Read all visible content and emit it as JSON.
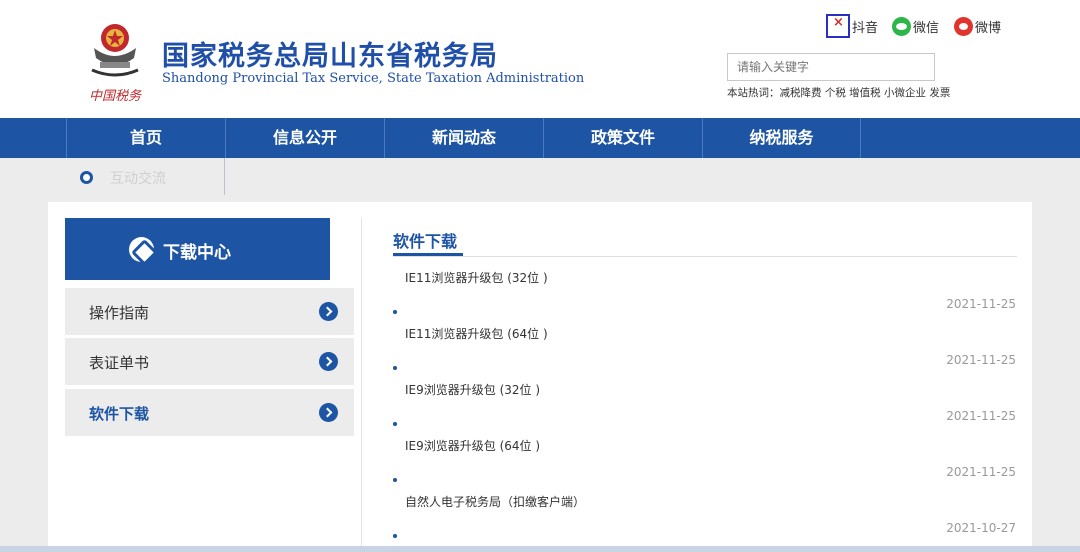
{
  "header": {
    "title_cn": "国家税务总局山东省税务局",
    "title_en": "Shandong Provincial Tax Service, State Taxation Administration",
    "social": {
      "douyin": "抖音",
      "wechat": "微信",
      "weibo": "微博"
    },
    "search": {
      "placeholder": "请输入关键字"
    },
    "hot_words": "本站热词：减税降费 个税 增值税 小微企业 发票"
  },
  "nav": {
    "items": [
      "首页",
      "信息公开",
      "新闻动态",
      "政策文件",
      "纳税服务"
    ]
  },
  "breadcrumb": {
    "text": "互动交流"
  },
  "sidebar": {
    "header": "下载中心",
    "items": [
      {
        "label": "操作指南"
      },
      {
        "label": "表证单书"
      },
      {
        "label": "软件下载",
        "active": true
      }
    ]
  },
  "content": {
    "section_title": "软件下载",
    "downloads": [
      {
        "name": "IE11浏览器升级包 (32位 )",
        "date": "2021-11-25"
      },
      {
        "name": "IE11浏览器升级包 (64位 )",
        "date": "2021-11-25"
      },
      {
        "name": "IE9浏览器升级包 (32位 )",
        "date": "2021-11-25"
      },
      {
        "name": "IE9浏览器升级包 (64位 )",
        "date": "2021-11-25"
      },
      {
        "name": "自然人电子税务局（扣缴客户端）",
        "date": "2021-10-27"
      }
    ]
  },
  "colors": {
    "brand_blue": "#1d55a4",
    "sidebar_bg": "#ececec"
  }
}
